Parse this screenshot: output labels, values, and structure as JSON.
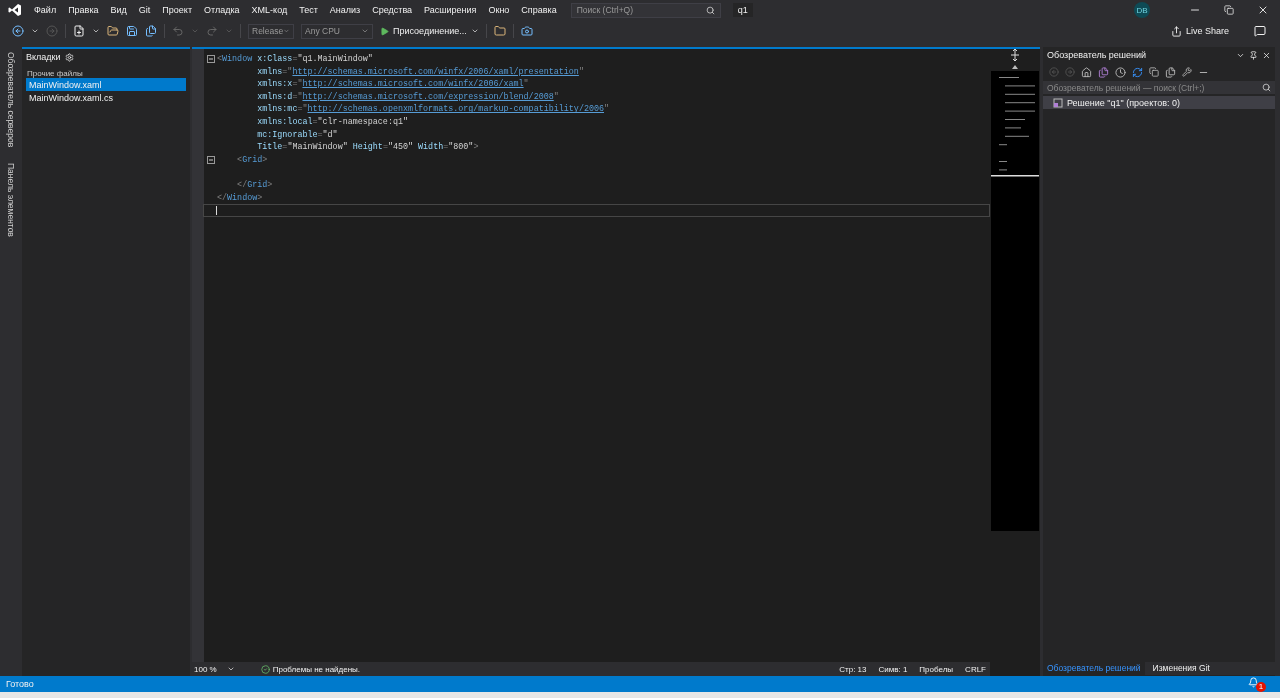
{
  "menu": [
    "Файл",
    "Правка",
    "Вид",
    "Git",
    "Проект",
    "Отладка",
    "XML-код",
    "Тест",
    "Анализ",
    "Средства",
    "Расширения",
    "Окно",
    "Справка"
  ],
  "search": {
    "placeholder": "Поиск (Ctrl+Q)"
  },
  "solution_badge": "q1",
  "account": {
    "initials": "DB"
  },
  "toolbar": {
    "configuration": {
      "value": "Release",
      "disabled": true
    },
    "platform": {
      "value": "Any CPU",
      "disabled": true
    },
    "run": "Присоединение...",
    "live_share": "Live Share"
  },
  "side_tabs": [
    "Обозреватель серверов",
    "Панель элементов"
  ],
  "tabs_panel": {
    "title": "Вкладки",
    "group": "Прочие файлы",
    "files": [
      {
        "name": "MainWindow.xaml",
        "selected": true
      },
      {
        "name": "MainWindow.xaml.cs",
        "selected": false
      }
    ]
  },
  "editor": {
    "lines": [
      {
        "foldable": true,
        "current": false,
        "segments": [
          {
            "kind": "punct",
            "text": "<"
          },
          {
            "kind": "tag",
            "text": "Window"
          },
          {
            "kind": "attr",
            "text": " x:Class"
          },
          {
            "kind": "punct",
            "text": "="
          },
          {
            "kind": "value",
            "text": "\"q1.MainWindow\""
          }
        ]
      },
      {
        "foldable": false,
        "current": false,
        "segments": [
          {
            "kind": "attr",
            "text": "        xmlns"
          },
          {
            "kind": "punct",
            "text": "=\""
          },
          {
            "kind": "link",
            "text": "http://schemas.microsoft.com/winfx/2006/xaml/presentation"
          },
          {
            "kind": "punct",
            "text": "\""
          }
        ]
      },
      {
        "foldable": false,
        "current": false,
        "segments": [
          {
            "kind": "attr",
            "text": "        xmlns:x"
          },
          {
            "kind": "punct",
            "text": "=\""
          },
          {
            "kind": "link",
            "text": "http://schemas.microsoft.com/winfx/2006/xaml"
          },
          {
            "kind": "punct",
            "text": "\""
          }
        ]
      },
      {
        "foldable": false,
        "current": false,
        "segments": [
          {
            "kind": "attr",
            "text": "        xmlns:d"
          },
          {
            "kind": "punct",
            "text": "=\""
          },
          {
            "kind": "link",
            "text": "http://schemas.microsoft.com/expression/blend/2008"
          },
          {
            "kind": "punct",
            "text": "\""
          }
        ]
      },
      {
        "foldable": false,
        "current": false,
        "segments": [
          {
            "kind": "attr",
            "text": "        xmlns:mc"
          },
          {
            "kind": "punct",
            "text": "=\""
          },
          {
            "kind": "link",
            "text": "http://schemas.openxmlformats.org/markup-compatibility/2006"
          },
          {
            "kind": "punct",
            "text": "\""
          }
        ]
      },
      {
        "foldable": false,
        "current": false,
        "segments": [
          {
            "kind": "attr",
            "text": "        xmlns:local"
          },
          {
            "kind": "punct",
            "text": "="
          },
          {
            "kind": "value",
            "text": "\"clr-namespace:q1\""
          }
        ]
      },
      {
        "foldable": false,
        "current": false,
        "segments": [
          {
            "kind": "attr",
            "text": "        mc:Ignorable"
          },
          {
            "kind": "punct",
            "text": "="
          },
          {
            "kind": "value",
            "text": "\"d\""
          }
        ]
      },
      {
        "foldable": false,
        "current": false,
        "segments": [
          {
            "kind": "attr",
            "text": "        Title"
          },
          {
            "kind": "punct",
            "text": "="
          },
          {
            "kind": "value",
            "text": "\"MainWindow\""
          },
          {
            "kind": "attr",
            "text": " Height"
          },
          {
            "kind": "punct",
            "text": "="
          },
          {
            "kind": "value",
            "text": "\"450\""
          },
          {
            "kind": "attr",
            "text": " Width"
          },
          {
            "kind": "punct",
            "text": "="
          },
          {
            "kind": "value",
            "text": "\"800\""
          },
          {
            "kind": "punct",
            "text": ">"
          }
        ]
      },
      {
        "foldable": true,
        "current": false,
        "segments": [
          {
            "kind": "punct",
            "text": "    <"
          },
          {
            "kind": "tag",
            "text": "Grid"
          },
          {
            "kind": "punct",
            "text": ">"
          }
        ]
      },
      {
        "foldable": false,
        "current": false
      },
      {
        "foldable": false,
        "current": false,
        "segments": [
          {
            "kind": "punct",
            "text": "    </"
          },
          {
            "kind": "tag",
            "text": "Grid"
          },
          {
            "kind": "punct",
            "text": ">"
          }
        ]
      },
      {
        "foldable": false,
        "current": false,
        "segments": [
          {
            "kind": "punct",
            "text": "</"
          },
          {
            "kind": "tag",
            "text": "Window"
          },
          {
            "kind": "punct",
            "text": ">"
          }
        ]
      },
      {
        "foldable": false,
        "current": true
      }
    ],
    "zoom": "100 %",
    "problems": "Проблемы не найдены.",
    "position": [
      "Стр: 13",
      "Симв: 1",
      "Пробелы",
      "CRLF"
    ]
  },
  "solution_explorer": {
    "title": "Обозреватель решений",
    "search": {
      "placeholder": "Обозреватель решений — поиск (Ctrl+;)"
    },
    "tree": [
      {
        "label": "Решение \"q1\"  (проектов: 0)"
      }
    ],
    "bottom_tabs": [
      {
        "label": "Обозреватель решений",
        "selected": true
      },
      {
        "label": "Изменения Git",
        "selected": false
      }
    ]
  },
  "status_bar": {
    "text": "Готово",
    "notifications": "1"
  }
}
